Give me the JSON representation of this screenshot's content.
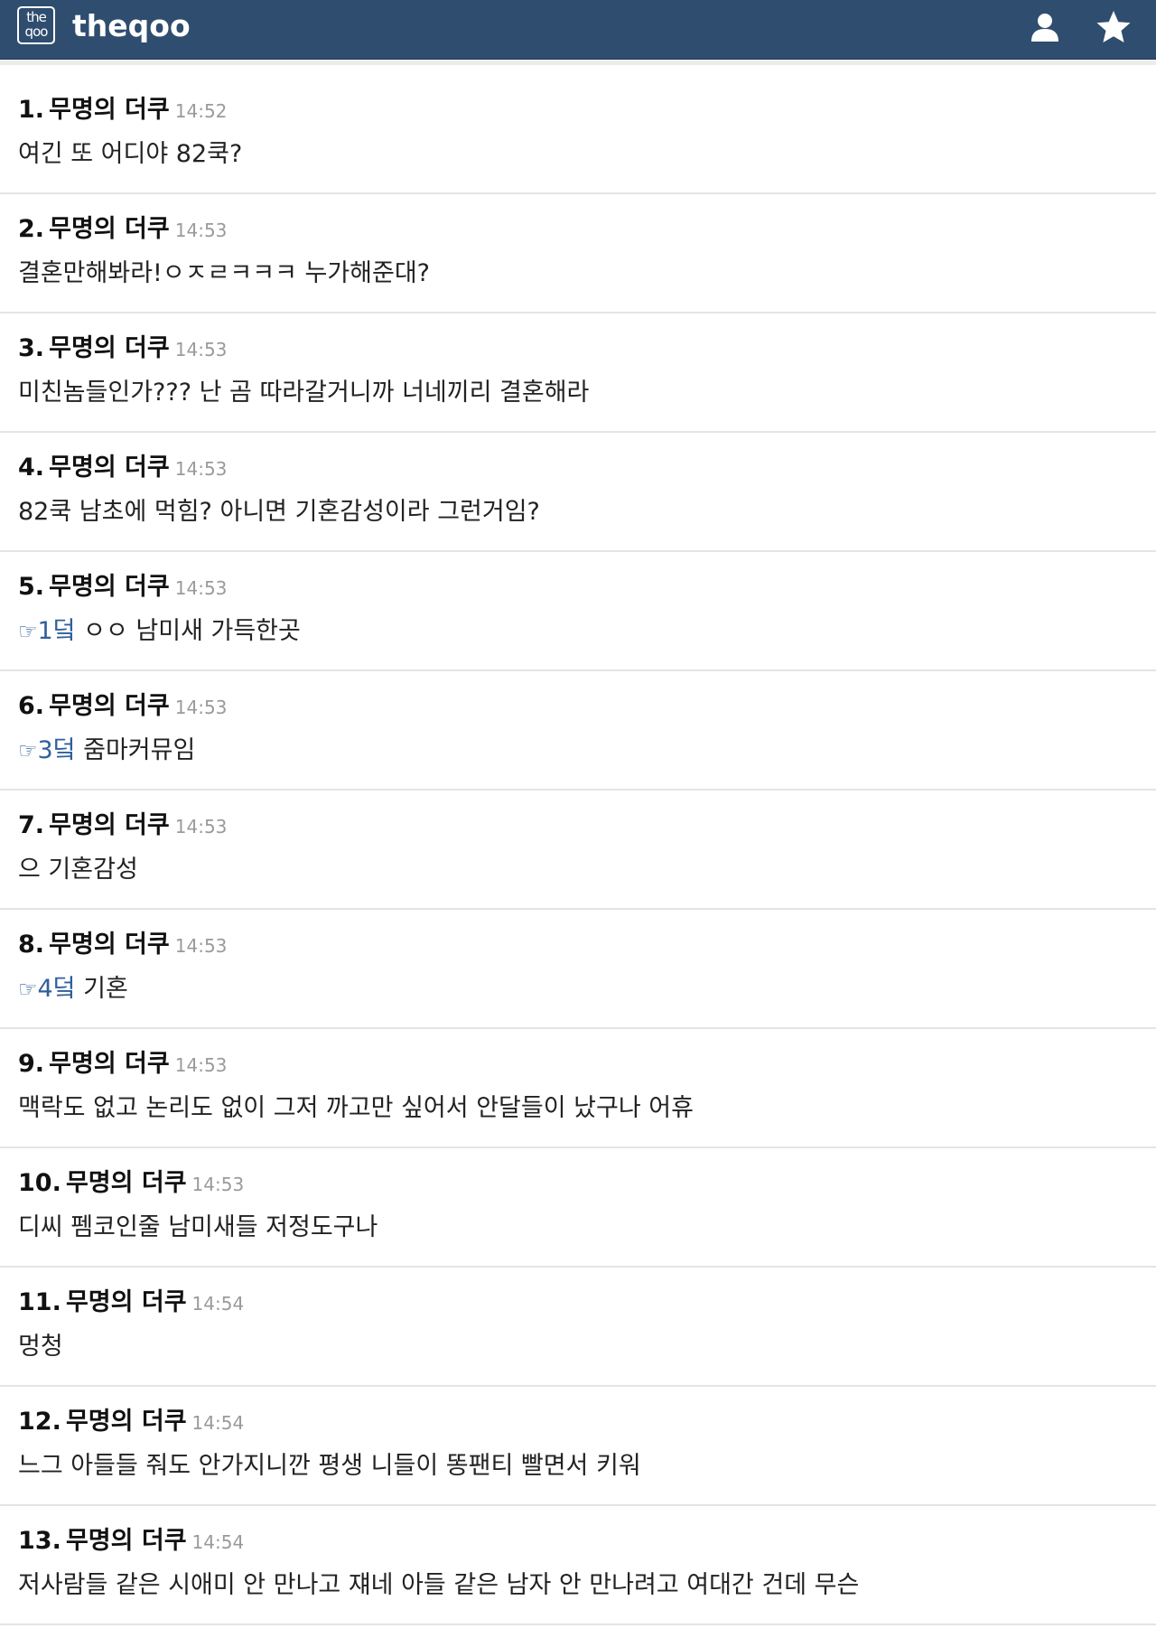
{
  "header": {
    "logo_top": "the",
    "logo_bottom": "qoo",
    "site_name": "theqoo",
    "icons": [
      "user-icon",
      "star-icon"
    ]
  },
  "comments": [
    {
      "num": "1.",
      "author": "무명의 더쿠",
      "time": "14:52",
      "ref": "",
      "text": "여긴 또 어디야 82쿡?"
    },
    {
      "num": "2.",
      "author": "무명의 더쿠",
      "time": "14:53",
      "ref": "",
      "text": "결혼만해봐라!ㅇㅈㄹㅋㅋㅋ 누가해준대?"
    },
    {
      "num": "3.",
      "author": "무명의 더쿠",
      "time": "14:53",
      "ref": "",
      "text": "미친놈들인가??? 난 곰 따라갈거니까 너네끼리 결혼해라"
    },
    {
      "num": "4.",
      "author": "무명의 더쿠",
      "time": "14:53",
      "ref": "",
      "text": "82쿡 남초에 먹힘? 아니면 기혼감성이라 그런거임?"
    },
    {
      "num": "5.",
      "author": "무명의 더쿠",
      "time": "14:53",
      "ref": "1덬",
      "text": " ㅇㅇ 남미새 가득한곳"
    },
    {
      "num": "6.",
      "author": "무명의 더쿠",
      "time": "14:53",
      "ref": "3덬",
      "text": " 줌마커뮤임"
    },
    {
      "num": "7.",
      "author": "무명의 더쿠",
      "time": "14:53",
      "ref": "",
      "text": "으 기혼감성"
    },
    {
      "num": "8.",
      "author": "무명의 더쿠",
      "time": "14:53",
      "ref": "4덬",
      "text": " 기혼"
    },
    {
      "num": "9.",
      "author": "무명의 더쿠",
      "time": "14:53",
      "ref": "",
      "text": "맥락도 없고 논리도 없이 그저 까고만 싶어서 안달들이 났구나 어휴"
    },
    {
      "num": "10.",
      "author": "무명의 더쿠",
      "time": "14:53",
      "ref": "",
      "text": "디씨 펨코인줄 남미새들 저정도구나"
    },
    {
      "num": "11.",
      "author": "무명의 더쿠",
      "time": "14:54",
      "ref": "",
      "text": "멍청"
    },
    {
      "num": "12.",
      "author": "무명의 더쿠",
      "time": "14:54",
      "ref": "",
      "text": "느그 아들들 줘도 안가지니깐 평생 니들이 똥팬티 빨면서 키워"
    },
    {
      "num": "13.",
      "author": "무명의 더쿠",
      "time": "14:54",
      "ref": "",
      "text": "저사람들 같은 시애미 안 만나고 쟤네 아들 같은 남자 안 만나려고 여대간 건데 무슨"
    }
  ],
  "colors": {
    "header_bg": "#2f4d6f",
    "reply_link": "#2f5f9a",
    "time_gray": "#9a9a9a"
  }
}
